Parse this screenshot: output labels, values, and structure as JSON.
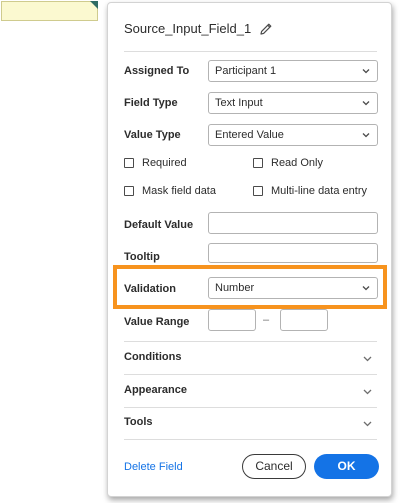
{
  "panel": {
    "title": "Source_Input_Field_1",
    "icons": {
      "edit": "pencil-icon",
      "dropdown": "chevron-down-icon"
    },
    "fields": {
      "assigned_to": {
        "label": "Assigned To",
        "value": "Participant 1"
      },
      "field_type": {
        "label": "Field Type",
        "value": "Text Input"
      },
      "value_type": {
        "label": "Value Type",
        "value": "Entered Value"
      },
      "default_value": {
        "label": "Default Value",
        "value": ""
      },
      "tooltip": {
        "label": "Tooltip",
        "value": ""
      },
      "validation": {
        "label": "Validation",
        "value": "Number"
      },
      "value_range": {
        "label": "Value Range",
        "min": "",
        "max": "",
        "separator": "–"
      }
    },
    "checkboxes": [
      {
        "label": "Required",
        "checked": false
      },
      {
        "label": "Read Only",
        "checked": false
      },
      {
        "label": "Mask field data",
        "checked": false
      },
      {
        "label": "Multi-line data entry",
        "checked": false
      }
    ],
    "sections": [
      {
        "label": "Conditions"
      },
      {
        "label": "Appearance"
      },
      {
        "label": "Tools"
      }
    ],
    "footer": {
      "delete_label": "Delete Field",
      "cancel_label": "Cancel",
      "ok_label": "OK"
    }
  },
  "colors": {
    "accent": "#1473e6",
    "highlight": "#f7931e",
    "field_fill": "#fbf9d0"
  }
}
